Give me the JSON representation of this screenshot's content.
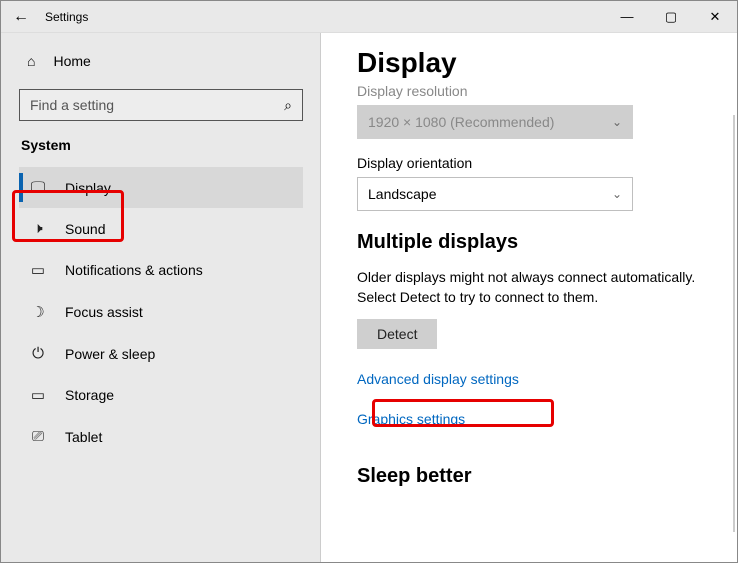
{
  "titlebar": {
    "title": "Settings"
  },
  "sidebar": {
    "home": "Home",
    "search_placeholder": "Find a setting",
    "category": "System",
    "items": [
      {
        "key": "display",
        "label": "Display"
      },
      {
        "key": "sound",
        "label": "Sound"
      },
      {
        "key": "notifications",
        "label": "Notifications & actions"
      },
      {
        "key": "focus",
        "label": "Focus assist"
      },
      {
        "key": "power",
        "label": "Power & sleep"
      },
      {
        "key": "storage",
        "label": "Storage"
      },
      {
        "key": "tablet",
        "label": "Tablet"
      }
    ]
  },
  "content": {
    "heading": "Display",
    "resolution_label": "Display resolution",
    "resolution_value": "1920 × 1080 (Recommended)",
    "orientation_label": "Display orientation",
    "orientation_value": "Landscape",
    "multi_heading": "Multiple displays",
    "multi_body": "Older displays might not always connect automatically. Select Detect to try to connect to them.",
    "detect_btn": "Detect",
    "link_advanced": "Advanced display settings",
    "link_graphics": "Graphics settings",
    "sleep_heading": "Sleep better"
  }
}
